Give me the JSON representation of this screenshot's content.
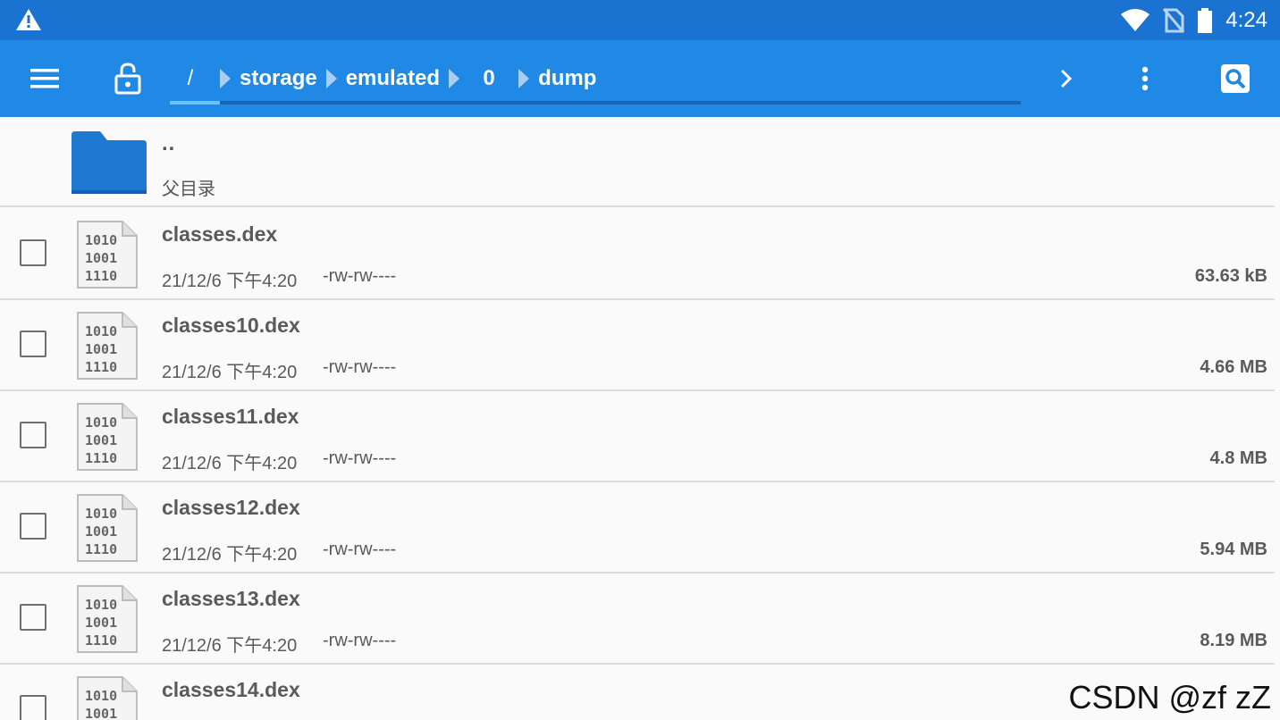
{
  "status_bar": {
    "time": "4:24",
    "icons": [
      "warning-icon",
      "wifi-icon",
      "no-sim-icon",
      "battery-icon"
    ]
  },
  "toolbar": {
    "breadcrumb": [
      "/",
      "storage",
      "emulated",
      "0",
      "dump"
    ],
    "icons": [
      "menu-icon",
      "lock-icon",
      "chevron-right-icon",
      "more-vert-icon",
      "search-icon"
    ],
    "color": "#2089e6"
  },
  "parent_dir": {
    "name": "..",
    "label": "父目录"
  },
  "files": [
    {
      "name": "classes.dex",
      "date": "21/12/6 下午4:20",
      "perm": "-rw-rw----",
      "size": "63.63 kB"
    },
    {
      "name": "classes10.dex",
      "date": "21/12/6 下午4:20",
      "perm": "-rw-rw----",
      "size": "4.66 MB"
    },
    {
      "name": "classes11.dex",
      "date": "21/12/6 下午4:20",
      "perm": "-rw-rw----",
      "size": "4.8 MB"
    },
    {
      "name": "classes12.dex",
      "date": "21/12/6 下午4:20",
      "perm": "-rw-rw----",
      "size": "5.94 MB"
    },
    {
      "name": "classes13.dex",
      "date": "21/12/6 下午4:20",
      "perm": "-rw-rw----",
      "size": "8.19 MB"
    },
    {
      "name": "classes14.dex",
      "date": "",
      "perm": "",
      "size": ""
    }
  ],
  "file_icon_text": [
    "1010",
    "1001",
    "1110"
  ],
  "watermark": "CSDN @zf zZ"
}
